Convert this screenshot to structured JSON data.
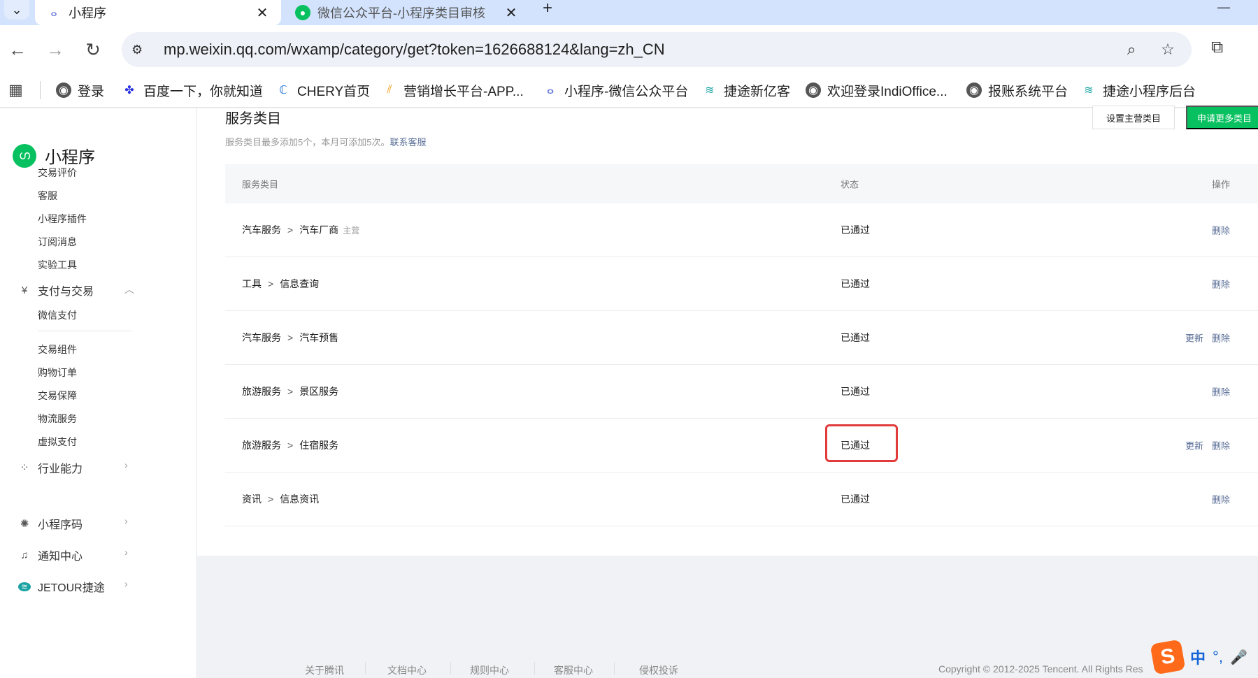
{
  "browser": {
    "tabs": [
      {
        "title": "小程序",
        "active": true
      },
      {
        "title": "微信公众平台-小程序类目审核",
        "active": false
      }
    ],
    "dropdown_glyph": "⌄",
    "close_glyph": "✕",
    "new_tab_glyph": "+",
    "minimize_glyph": "—",
    "back_glyph": "←",
    "forward_glyph": "→",
    "reload_glyph": "↻",
    "url": "mp.weixin.qq.com/wxamp/category/get?token=1626688124&lang=zh_CN",
    "bookmarks": [
      {
        "label": "登录",
        "icon": "globe-icon"
      },
      {
        "label": "百度一下，你就知道",
        "icon": "baidu-icon"
      },
      {
        "label": "CHERY首页",
        "icon": "chery-icon"
      },
      {
        "label": "营销增长平台-APP...",
        "icon": "marketing-icon"
      },
      {
        "label": "小程序-微信公众平台",
        "icon": "miniprogram-icon"
      },
      {
        "label": "捷途新亿客",
        "icon": "jetour-icon"
      },
      {
        "label": "欢迎登录IndiOffice...",
        "icon": "globe-icon"
      },
      {
        "label": "报账系统平台",
        "icon": "globe-icon"
      },
      {
        "label": "捷途小程序后台",
        "icon": "jetour-icon"
      }
    ]
  },
  "sidebar": {
    "brand": "小程序",
    "items": [
      {
        "label": "交易评价",
        "kind": "sub"
      },
      {
        "label": "客服",
        "kind": "sub"
      },
      {
        "label": "小程序插件",
        "kind": "sub"
      },
      {
        "label": "订阅消息",
        "kind": "sub"
      },
      {
        "label": "实验工具",
        "kind": "sub"
      },
      {
        "label": "支付与交易",
        "kind": "group",
        "icon": "yuan-icon",
        "chevron": "︿"
      },
      {
        "label": "微信支付",
        "kind": "sub"
      },
      {
        "label": "交易组件",
        "kind": "sub"
      },
      {
        "label": "购物订单",
        "kind": "sub"
      },
      {
        "label": "交易保障",
        "kind": "sub"
      },
      {
        "label": "物流服务",
        "kind": "sub"
      },
      {
        "label": "虚拟支付",
        "kind": "sub"
      },
      {
        "label": "行业能力",
        "kind": "group",
        "icon": "industry-icon",
        "chevron": "›"
      },
      {
        "label": "小程序码",
        "kind": "group",
        "icon": "qrcode-icon",
        "chevron": "›"
      },
      {
        "label": "通知中心",
        "kind": "group",
        "icon": "bell-icon",
        "chevron": "›"
      },
      {
        "label": "JETOUR捷途",
        "kind": "group",
        "icon": "account-avatar-icon",
        "chevron": "›"
      }
    ]
  },
  "section": {
    "title": "服务类目",
    "desc": "服务类目最多添加5个，本月可添加5次。",
    "desc_link": "联系客服",
    "btn_set_main": "设置主营类目",
    "btn_apply_more": "申请更多类目"
  },
  "table": {
    "headers": {
      "category": "服务类目",
      "status": "状态",
      "ops": "操作"
    },
    "arrow": ">",
    "rows": [
      {
        "cat1": "汽车服务",
        "cat2": "汽车厂商",
        "tag": "主营",
        "status": "已通过",
        "update": "",
        "delete": "删除"
      },
      {
        "cat1": "工具",
        "cat2": "信息查询",
        "tag": "",
        "status": "已通过",
        "update": "",
        "delete": "删除"
      },
      {
        "cat1": "汽车服务",
        "cat2": "汽车预售",
        "tag": "",
        "status": "已通过",
        "update": "更新",
        "delete": "删除"
      },
      {
        "cat1": "旅游服务",
        "cat2": "景区服务",
        "tag": "",
        "status": "已通过",
        "update": "",
        "delete": "删除"
      },
      {
        "cat1": "旅游服务",
        "cat2": "住宿服务",
        "tag": "",
        "status": "已通过",
        "update": "更新",
        "delete": "删除",
        "highlighted": true
      },
      {
        "cat1": "资讯",
        "cat2": "信息资讯",
        "tag": "",
        "status": "已通过",
        "update": "",
        "delete": "删除"
      }
    ]
  },
  "footer": {
    "links": [
      "关于腾讯",
      "文档中心",
      "规则中心",
      "客服中心",
      "侵权投诉"
    ],
    "copyright": "Copyright © 2012-2025 Tencent. All Rights Res"
  },
  "ime": {
    "logo": "S",
    "mode": "中",
    "punct": "°,",
    "mic": "🎤"
  },
  "colors": {
    "accent": "#07c160",
    "link": "#576b95",
    "highlight": "#e23b3b"
  }
}
